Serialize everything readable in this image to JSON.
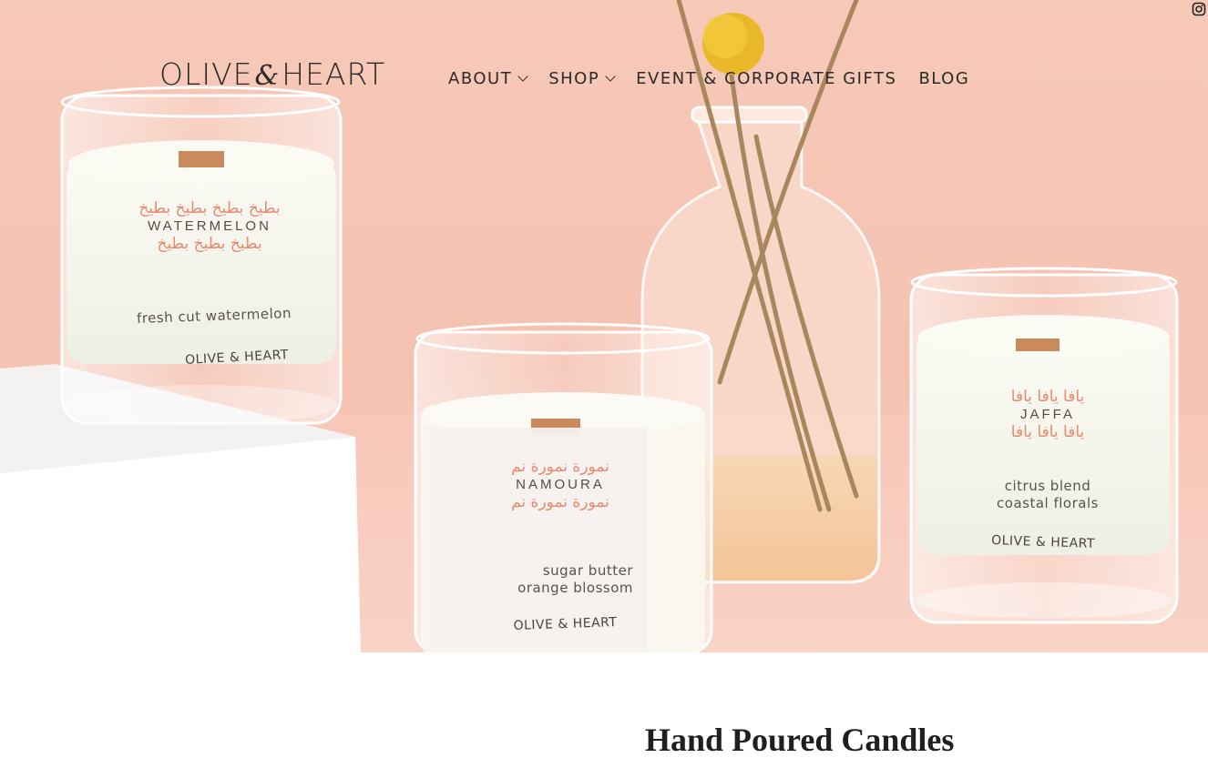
{
  "header": {
    "logo": {
      "left": "OLIVE",
      "amp": "&",
      "right": "HEART"
    },
    "nav": [
      {
        "label": "ABOUT",
        "dropdown": true
      },
      {
        "label": "SHOP",
        "dropdown": true
      },
      {
        "label": "EVENT & CORPORATE GIFTS",
        "dropdown": false
      },
      {
        "label": "BLOG",
        "dropdown": false
      }
    ],
    "social_icon": "instagram-icon"
  },
  "hero": {
    "candles": [
      {
        "arabic_line1": "بطيخ بطيخ بطيخ بطيخ",
        "name": "WATERMELON",
        "arabic_line3": "بطيخ بطيخ بطيخ",
        "scent": "fresh cut watermelon",
        "brand": "OLIVE & HEART"
      },
      {
        "arabic_line1": "نمورة نمورة نم",
        "name": "NAMOURA",
        "arabic_line3": "نمورة نمورة نم",
        "scent_line1": "sugar butter",
        "scent_line2": "orange blossom",
        "brand": "OLIVE & HEART"
      },
      {
        "arabic_line1": "يافا يافا يافا",
        "name": "JAFFA",
        "arabic_line3": "يافا يافا يافا",
        "scent_line1": "citrus blend",
        "scent_line2": "coastal florals",
        "brand": "OLIVE & HEART"
      }
    ],
    "colors": {
      "background": "#f6c6b6",
      "accent_text": "#e88a6f"
    }
  },
  "main": {
    "section_title": "Hand Poured Candles"
  }
}
